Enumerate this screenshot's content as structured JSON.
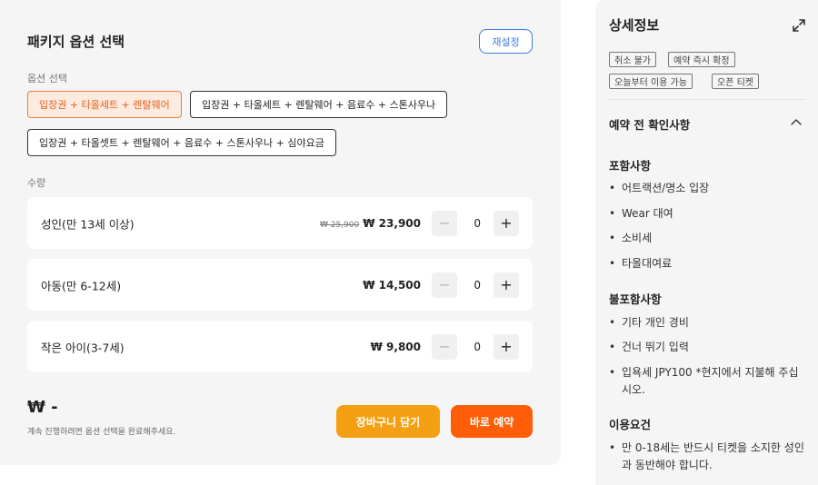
{
  "options_panel": {
    "title": "패키지 옵션 선택",
    "reset_label": "재설정",
    "option_section_label": "옵션 선택",
    "options": [
      {
        "label": "입장권 + 타올세트 + 렌탈웨어",
        "selected": true
      },
      {
        "label": "입장권 + 타올세트 + 렌탈웨어 + 음료수 + 스톤사우나",
        "selected": false
      },
      {
        "label": "입장권 + 타올셋트 + 렌탈웨어 + 음료수 + 스톤사우나 + 심야요금",
        "selected": false
      }
    ],
    "quantity_section_label": "수량",
    "quantities": [
      {
        "label": "성인(만 13세 이상)",
        "original_price": "₩ 25,900",
        "price": "₩ 23,900",
        "count": "0",
        "minus": "−",
        "plus": "+"
      },
      {
        "label": "아동(만 6-12세)",
        "original_price": "",
        "price": "₩ 14,500",
        "count": "0",
        "minus": "−",
        "plus": "+"
      },
      {
        "label": "작은 아이(3-7세)",
        "original_price": "",
        "price": "₩ 9,800",
        "count": "0",
        "minus": "−",
        "plus": "+"
      }
    ],
    "total": "₩ -",
    "hint": "계속 진행하려면 옵션 선택을 완료해주세요.",
    "cart_label": "장바구니 담기",
    "book_label": "바로 예약"
  },
  "details_panel": {
    "title": "상세정보",
    "tags": [
      "취소 불가",
      "예약 즉시 확정",
      "오늘부터 이용 가능",
      "오픈 티켓"
    ],
    "accordion_title": "예약 전 확인사항",
    "included_title": "포함사항",
    "included": [
      "어트랙션/명소 입장",
      "Wear 대여",
      "소비세",
      "타올대여료"
    ],
    "excluded_title": "불포함사항",
    "excluded": [
      "기타 개인 경비",
      "건너 뛰기 입력",
      "입욕세 JPY100 *현지에서 지불해 주십시오."
    ],
    "requirements_title": "이용요건",
    "requirements": [
      "만 0-18세는 반드시 티켓을 소지한 성인과 동반해야 합니다."
    ]
  },
  "colors": {
    "selected_chip_bg": "#fdebe0",
    "selected_chip_text": "#e4621c",
    "cart_button": "#f5a013",
    "book_button": "#ff5d08",
    "reset_accent": "#3d7ce0"
  },
  "icons": {
    "expand": "expand-icon",
    "collapse": "chevron-up-icon"
  }
}
